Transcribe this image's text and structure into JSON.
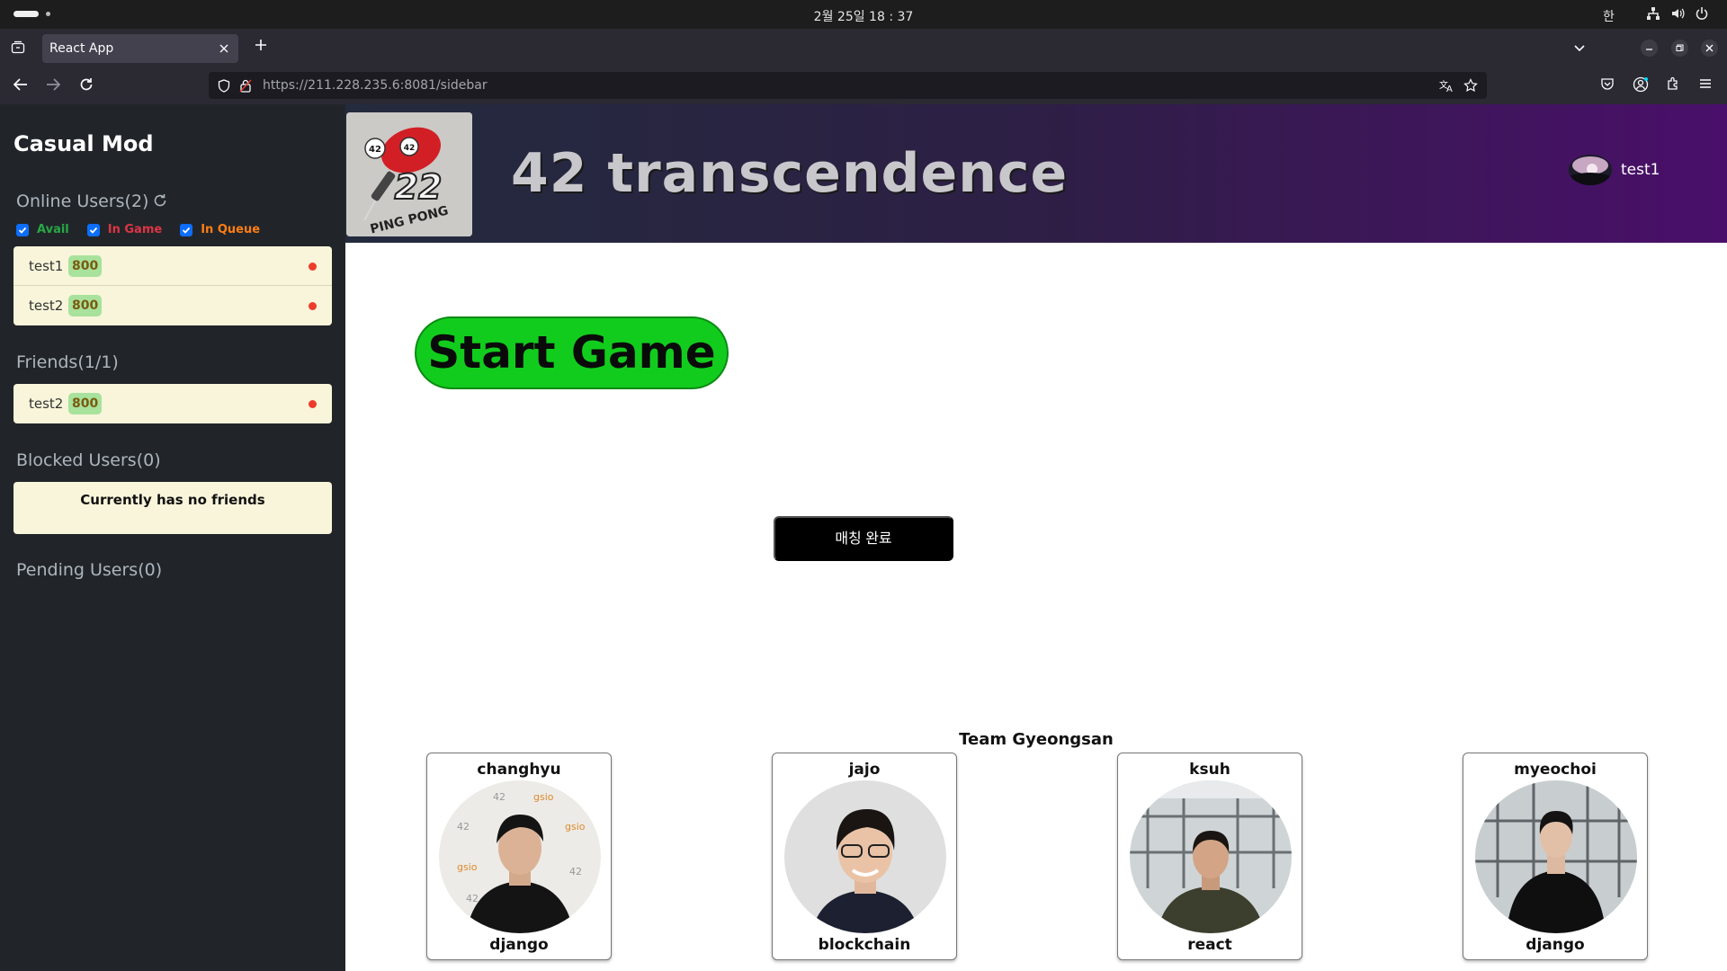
{
  "os": {
    "clock": "2월 25일  18 : 37",
    "ime": "한"
  },
  "browser": {
    "tab_title": "React App",
    "url_host": "https://211.228.235.6",
    "url_rest": ":8081/sidebar"
  },
  "sidebar": {
    "brand": "Casual Mod",
    "online_title": "Online Users(2)",
    "filters": {
      "avail": "Avail",
      "in_game": "In Game",
      "in_queue": "In Queue"
    },
    "online_users": [
      {
        "name": "test1",
        "rating": "800"
      },
      {
        "name": "test2",
        "rating": "800"
      }
    ],
    "friends_title": "Friends(1/1)",
    "friends": [
      {
        "name": "test2",
        "rating": "800"
      }
    ],
    "blocked_title": "Blocked Users(0)",
    "blocked_empty": "Currently has no friends",
    "pending_title": "Pending Users(0)"
  },
  "header": {
    "title": "42 transcendence",
    "logo_text": "PING PONG",
    "logo_number": "22",
    "logo_ball_left": "42",
    "logo_ball_right": "42",
    "username": "test1"
  },
  "main": {
    "start_label": "Start Game",
    "match_label": "매칭 완료",
    "team_title": "Team Gyeongsan",
    "members": [
      {
        "name": "changhyu",
        "role": "django"
      },
      {
        "name": "jajo",
        "role": "blockchain"
      },
      {
        "name": "ksuh",
        "role": "react"
      },
      {
        "name": "myeochoi",
        "role": "django"
      }
    ]
  },
  "colors": {
    "sidebar_bg": "#212529",
    "panel_bg": "#f8f5da",
    "start_green": "#12cc1d",
    "status_red": "#ee3b2c"
  },
  "icons": [
    "refresh-icon",
    "checkbox-icon",
    "shield-icon",
    "lock-icon",
    "translate-icon",
    "star-icon",
    "pocket-icon",
    "account-icon",
    "extensions-icon",
    "menu-icon",
    "back-icon",
    "forward-icon",
    "reload-icon",
    "close-icon",
    "plus-icon",
    "chevron-down-icon",
    "network-icon",
    "volume-icon",
    "power-icon"
  ]
}
